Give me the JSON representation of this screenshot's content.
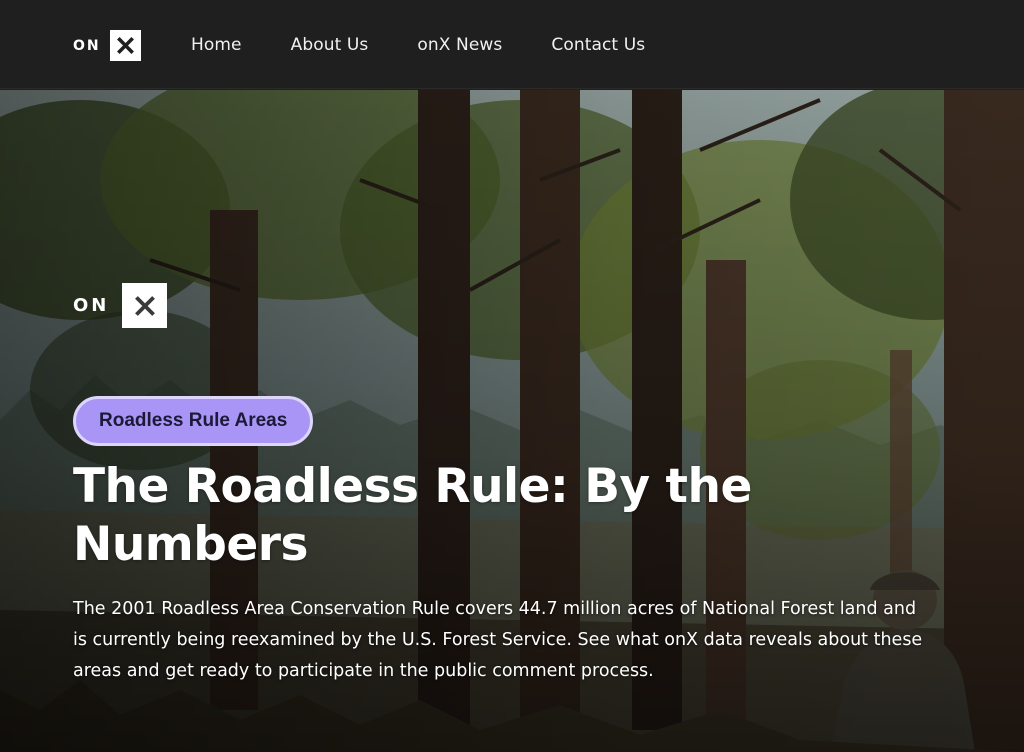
{
  "nav": {
    "logo_text": "ON",
    "logo_icon": "x-mark-icon",
    "links": [
      {
        "label": "Home"
      },
      {
        "label": "About Us"
      },
      {
        "label": "onX News"
      },
      {
        "label": "Contact Us"
      }
    ]
  },
  "hero": {
    "background_image": "forest-hunter-photo",
    "logo_text": "ON",
    "logo_icon": "x-mark-icon",
    "tag": "Roadless Rule Areas",
    "headline": "The Roadless Rule: By the Numbers",
    "lede": "The 2001 Roadless Area Conservation Rule covers 44.7 million acres of National Forest land and is currently being reexamined by the U.S. Forest Service. See what onX data reveals about these areas and get ready to participate in the public comment process."
  },
  "colors": {
    "nav_background": "#1f1f1f",
    "tag_background": "#a995f5",
    "tag_border": "#ddd5fb",
    "tag_text": "#1c1a38"
  }
}
